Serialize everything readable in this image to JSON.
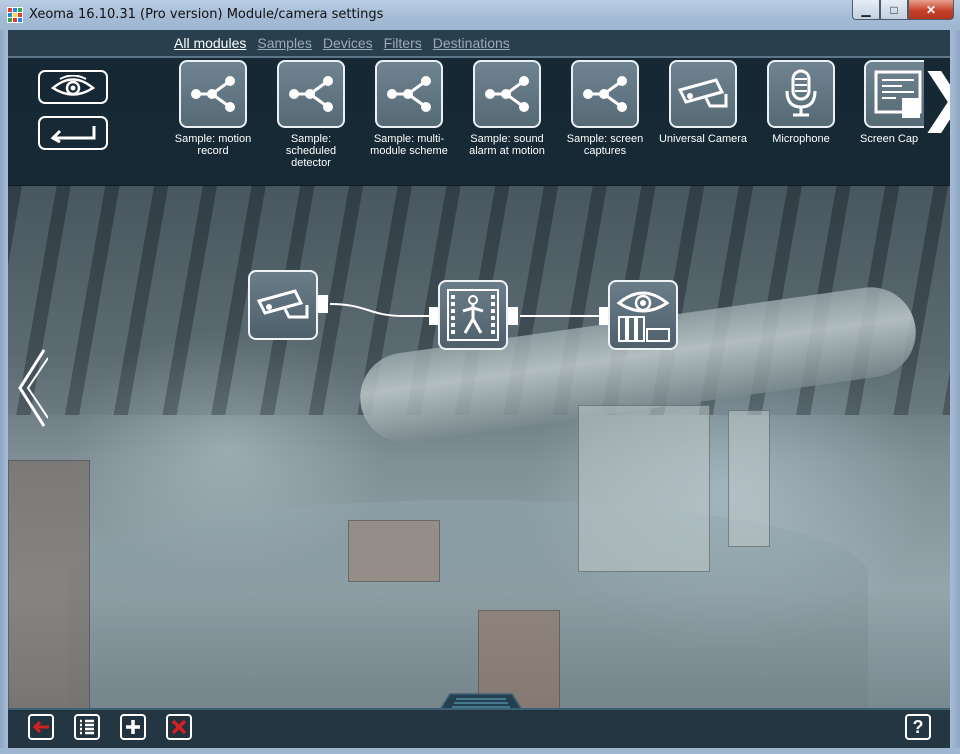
{
  "window": {
    "title": "Xeoma 16.10.31 (Pro version) Module/camera settings",
    "minimize": "▁",
    "maximize": "□",
    "close": "✕"
  },
  "tabs": [
    {
      "label": "All modules",
      "active": true
    },
    {
      "label": "Samples",
      "active": false
    },
    {
      "label": "Devices",
      "active": false
    },
    {
      "label": "Filters",
      "active": false
    },
    {
      "label": "Destinations",
      "active": false
    }
  ],
  "modules": [
    {
      "label": "Sample: motion record",
      "icon": "scheme-icon"
    },
    {
      "label": "Sample: scheduled detector",
      "icon": "scheme-icon"
    },
    {
      "label": "Sample: multi-module scheme",
      "icon": "scheme-icon"
    },
    {
      "label": "Sample: sound alarm at motion",
      "icon": "scheme-icon"
    },
    {
      "label": "Sample: screen captures",
      "icon": "scheme-icon"
    },
    {
      "label": "Universal Camera",
      "icon": "camera-icon"
    },
    {
      "label": "Microphone",
      "icon": "microphone-icon"
    },
    {
      "label": "Screen Cap",
      "icon": "screen-capture-icon"
    }
  ],
  "colors": {
    "accent": "#ffffff",
    "panel": "#142632",
    "delete": "#d42020"
  },
  "help_label": "?"
}
